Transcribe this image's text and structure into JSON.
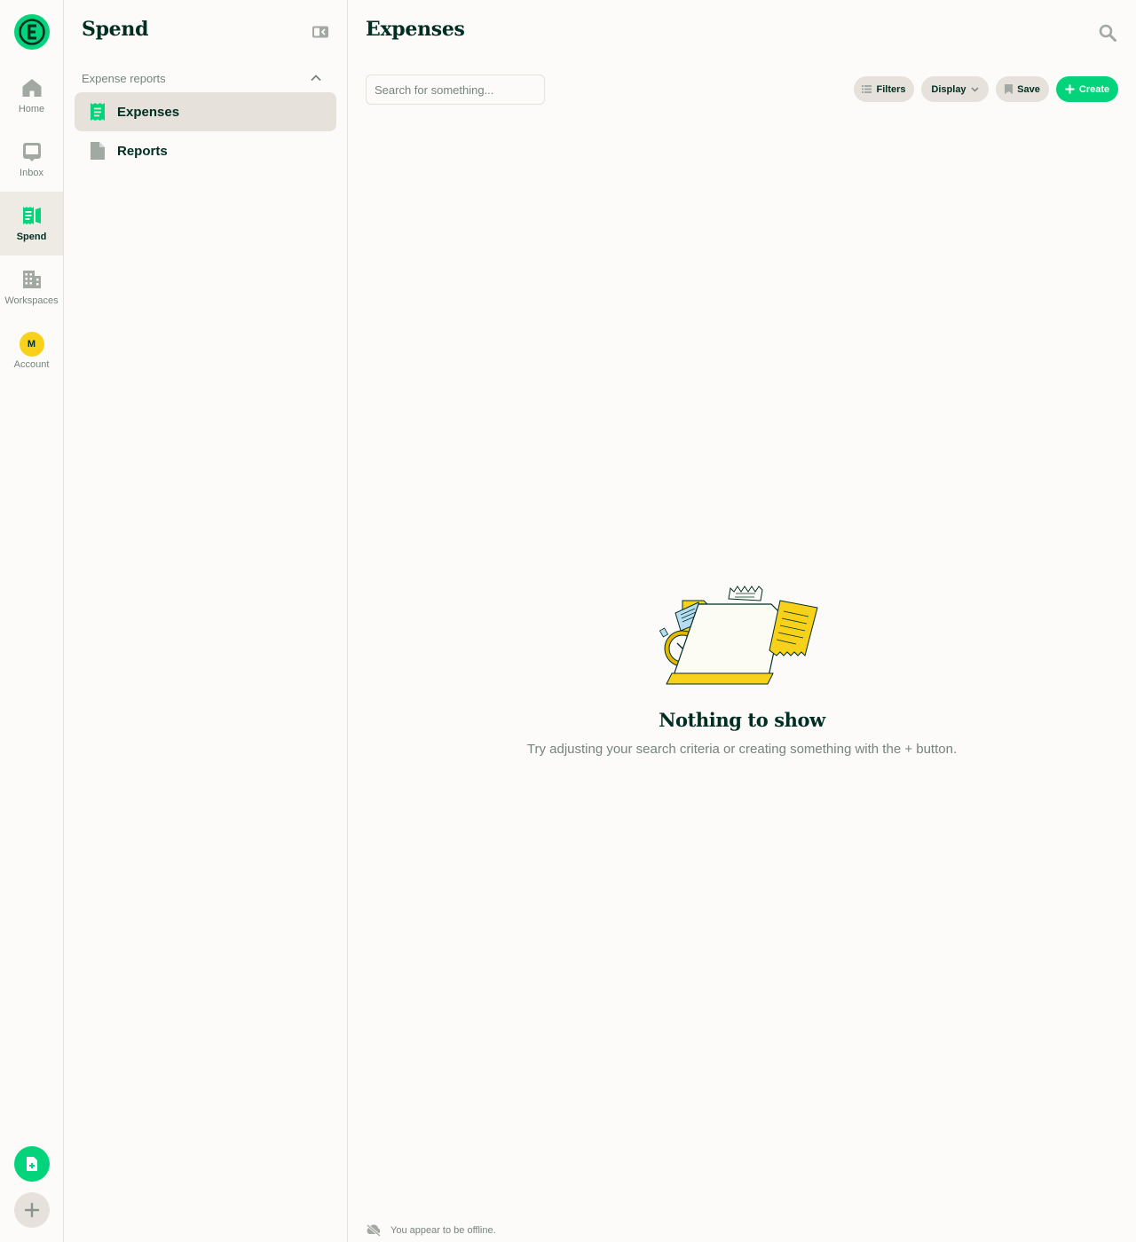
{
  "rail": {
    "items": [
      {
        "label": "Home",
        "icon": "home-icon"
      },
      {
        "label": "Inbox",
        "icon": "inbox-icon"
      },
      {
        "label": "Spend",
        "icon": "receipt-icon",
        "active": true
      },
      {
        "label": "Workspaces",
        "icon": "building-icon"
      },
      {
        "label": "Account",
        "icon": "avatar",
        "initial": "M"
      }
    ]
  },
  "sidebar": {
    "title": "Spend",
    "section": "Expense reports",
    "items": [
      {
        "label": "Expenses",
        "active": true
      },
      {
        "label": "Reports"
      }
    ]
  },
  "main": {
    "title": "Expenses",
    "search_placeholder": "Search for something...",
    "buttons": {
      "filters": "Filters",
      "display": "Display",
      "save": "Save",
      "create": "Create"
    },
    "empty": {
      "title": "Nothing to show",
      "subtitle": "Try adjusting your search criteria or creating something with the + button."
    },
    "offline": "You appear to be offline."
  },
  "colors": {
    "accent": "#03D47C",
    "text": "#002E22",
    "muted": "#76847E",
    "border": "#E6E1DA",
    "background": "#FCFBF9",
    "avatar": "#F8D11A"
  }
}
